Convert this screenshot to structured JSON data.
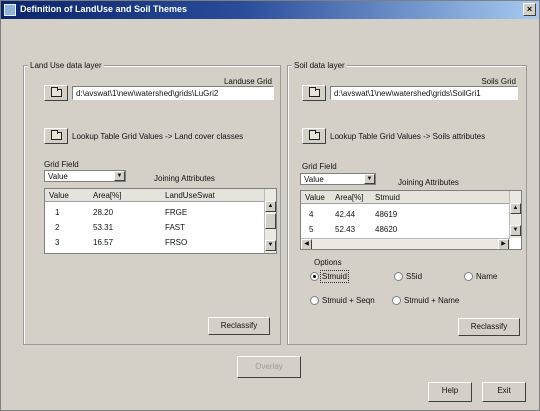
{
  "window": {
    "title": "Definition of LandUse and Soil Themes",
    "close_label": "×"
  },
  "landuse": {
    "group_label": "Land Use data layer",
    "grid_label": "Landuse Grid",
    "grid_path": "d:\\avswat\\1\\new\\watershed\\grids\\LuGri2",
    "lookup_label": "Lookup Table  Grid Values -> Land cover classes",
    "grid_field_label": "Grid Field",
    "grid_field_value": "Value",
    "joining_label": "Joining Attributes",
    "columns": [
      "Value",
      "Area[%]",
      "LandUseSwat"
    ],
    "rows": [
      [
        "1",
        "28.20",
        "FRGE"
      ],
      [
        "2",
        "53.31",
        "FAST"
      ],
      [
        "3",
        "16.57",
        "FRSO"
      ]
    ],
    "reclassify_label": "Reclassify"
  },
  "soil": {
    "group_label": "Soil data layer",
    "grid_label": "Soils Grid",
    "grid_path": "d:\\avswat\\1\\new\\watershed\\grids\\SoilGri1",
    "lookup_label": "Lookup Table  Grid Values -> Soils attributes",
    "grid_field_label": "Grid Field",
    "grid_field_value": "Value",
    "joining_label": "Joining Attributes",
    "columns": [
      "Value",
      "Area[%]",
      "Stmuid"
    ],
    "rows": [
      [
        "4",
        "42.44",
        "48619"
      ],
      [
        "5",
        "52.43",
        "48620"
      ]
    ],
    "option_label": "Options",
    "options": [
      "Stmuid",
      "S5id",
      "Name",
      "Stmuid + Seqn",
      "Stmuid + Name"
    ],
    "selected_option": "Stmuid",
    "reclassify_label": "Reclassify"
  },
  "footer": {
    "overlay_label": "Overlay",
    "help_label": "Help",
    "exit_label": "Exit"
  },
  "colors": {
    "titlebar_start": "#0a246a",
    "titlebar_end": "#a6caf0",
    "face": "#d4d0c8"
  }
}
